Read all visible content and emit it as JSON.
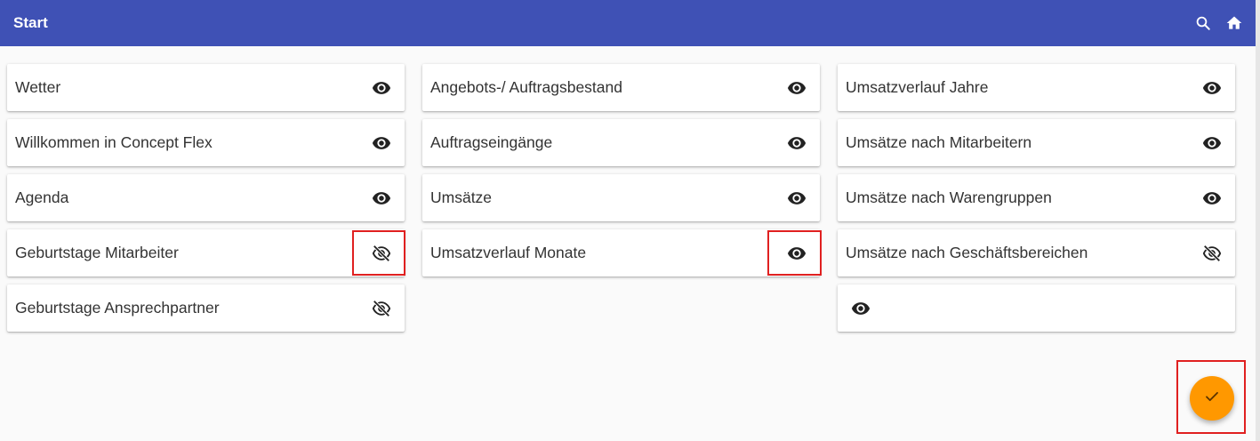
{
  "header": {
    "title": "Start",
    "icons": [
      "search-icon",
      "home-icon"
    ]
  },
  "columns": [
    {
      "items": [
        {
          "label": "Wetter",
          "visible": true
        },
        {
          "label": "Willkommen in Concept Flex",
          "visible": true
        },
        {
          "label": "Agenda",
          "visible": true
        },
        {
          "label": "Geburtstage Mitarbeiter",
          "visible": false
        },
        {
          "label": "Geburtstage Ansprechpartner",
          "visible": false
        }
      ]
    },
    {
      "items": [
        {
          "label": "Angebots-/ Auftragsbestand",
          "visible": true
        },
        {
          "label": "Auftragseingänge",
          "visible": true
        },
        {
          "label": "Umsätze",
          "visible": true
        },
        {
          "label": "Umsatzverlauf Monate",
          "visible": true
        }
      ]
    },
    {
      "items": [
        {
          "label": "Umsatzverlauf Jahre",
          "visible": true
        },
        {
          "label": "Umsätze nach Mitarbeitern",
          "visible": true
        },
        {
          "label": "Umsätze nach Warengruppen",
          "visible": true
        },
        {
          "label": "Umsätze nach Geschäftsbereichen",
          "visible": false
        },
        {
          "label": "",
          "visible": true
        }
      ]
    }
  ],
  "fab": {
    "icon": "check-icon",
    "color": "#ff9800"
  },
  "colors": {
    "appbar": "#3f51b5",
    "background": "#fafafa",
    "highlight": "#e02020"
  }
}
